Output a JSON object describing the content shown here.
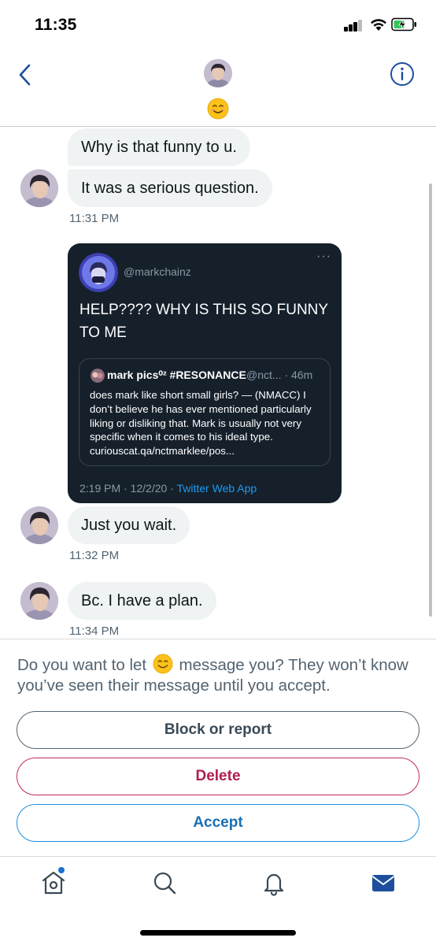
{
  "status_bar": {
    "time": "11:35"
  },
  "header": {
    "profile_emoji": "smiling-face-icon",
    "accent_color": "#1d4f9e"
  },
  "messages": [
    {
      "text": "Why is that funny to u."
    },
    {
      "text": "It was a serious question."
    }
  ],
  "timestamps": {
    "t1": "11:31 PM",
    "t2": "11:32 PM",
    "t3": "11:34 PM"
  },
  "tweet": {
    "handle": "@markchainz",
    "more": "···",
    "text": "HELP???? WHY IS THIS SO FUNNY TO ME",
    "quote": {
      "name": "mark pics⁰² #RESONANCE",
      "handle": "@nct... · 46m",
      "text": "does mark like short small girls? — (NMACC) I don’t believe he has ever mentioned particularly liking or disliking that. Mark is usually not very specific when it comes to his ideal type.  curiouscat.qa/nctmarklee/pos..."
    },
    "meta_time": "2:19 PM · 12/2/20 · ",
    "meta_source": "Twitter Web App"
  },
  "later_messages": [
    {
      "text": "Just you wait."
    },
    {
      "text": "Bc. I have a plan."
    }
  ],
  "request": {
    "text_before": "Do you want to let",
    "text_after": "message you? They won’t know you’ve seen their message until you accept.",
    "block_label": "Block or report",
    "delete_label": "Delete",
    "accept_label": "Accept"
  },
  "colors": {
    "bubble": "#eff3f4",
    "delete": "#b01e4e",
    "accept": "#1a6fb5",
    "tweet_bg": "#15202b"
  }
}
